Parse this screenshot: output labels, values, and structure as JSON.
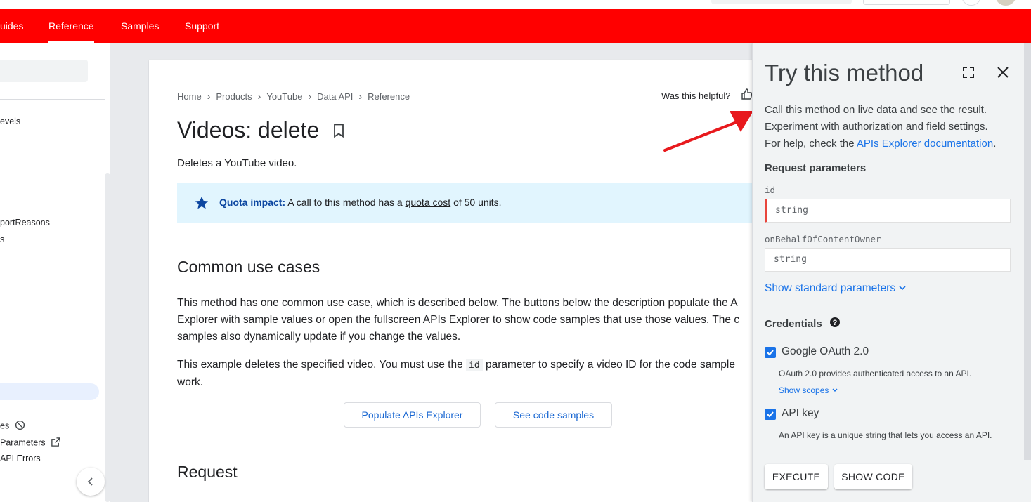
{
  "nav": {
    "tabs": [
      "uides",
      "Reference",
      "Samples",
      "Support"
    ],
    "active": "Reference"
  },
  "sidebar": {
    "items": [
      "evels",
      "portReasons",
      "s",
      "es",
      "Parameters",
      "API Errors"
    ]
  },
  "breadcrumb": [
    "Home",
    "Products",
    "YouTube",
    "Data API",
    "Reference"
  ],
  "helpful_label": "Was this helpful?",
  "page": {
    "title": "Videos: delete",
    "description": "Deletes a YouTube video.",
    "quota": {
      "bold": "Quota impact:",
      "pre": "A call to this method has a",
      "link": "quota cost",
      "post": "of 50 units."
    },
    "common_heading": "Common use cases",
    "para1_line1": "This method has one common use case, which is described below. The buttons below the description populate the A",
    "para1_line2": "Explorer with sample values or open the fullscreen APIs Explorer to show code samples that use those values. The c",
    "para1_line3": "samples also dynamically update if you change the values.",
    "para2_pre": "This example deletes the specified video. You must use the",
    "para2_code": "id",
    "para2_post": "parameter to specify a video ID for the code sample",
    "para2_line2": "work.",
    "btn_populate": "Populate APIs Explorer",
    "btn_samples": "See code samples",
    "request_heading": "Request"
  },
  "panel": {
    "title": "Try this method",
    "intro_line1": "Call this method on live data and see the result.",
    "intro_line2": "Experiment with authorization and field settings.",
    "intro_pre": "For help, check the",
    "intro_link": "APIs Explorer documentation",
    "intro_post": ".",
    "request_params": "Request parameters",
    "param1": {
      "name": "id",
      "placeholder": "string"
    },
    "param2": {
      "name": "onBehalfOfContentOwner",
      "placeholder": "string"
    },
    "show_std": "Show standard parameters",
    "credentials": "Credentials",
    "oauth_label": "Google OAuth 2.0",
    "oauth_desc": "OAuth 2.0 provides authenticated access to an API.",
    "show_scopes": "Show scopes",
    "apikey_label": "API key",
    "apikey_desc": "An API key is a unique string that lets you access an API.",
    "execute": "EXECUTE",
    "show_code": "SHOW CODE"
  },
  "colors": {
    "brand": "#ff0000",
    "link": "#1a73e8",
    "quota_bg": "#e1f5fe",
    "arrow": "#e8191d"
  }
}
